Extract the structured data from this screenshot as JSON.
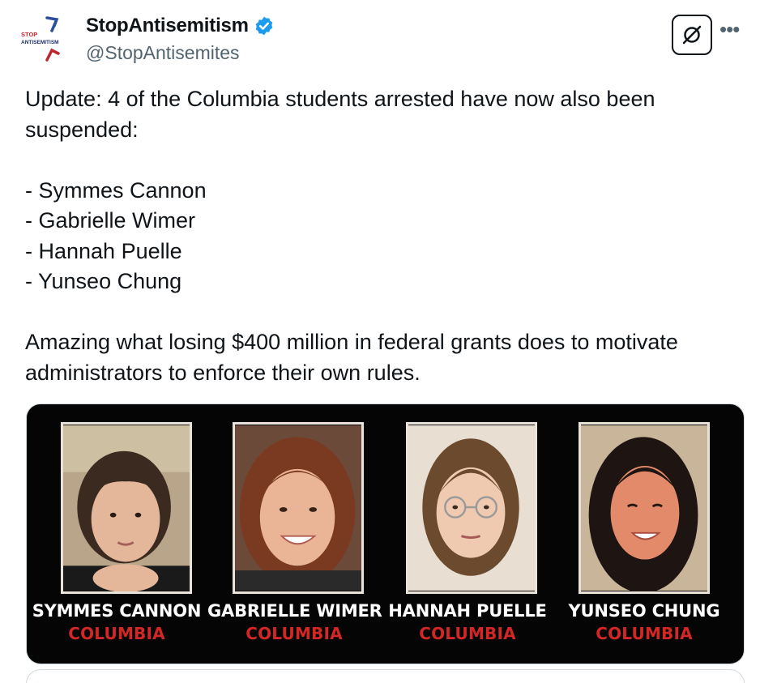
{
  "author": {
    "display_name": "StopAntisemitism",
    "handle": "@StopAntisemites",
    "verified": true,
    "logo_text_top": "STOP",
    "logo_text_bottom": "ANTISEMITISM"
  },
  "icons": {
    "verified": "verified-badge-icon",
    "grok": "grok-icon",
    "more": "more-icon"
  },
  "tweet": {
    "line1": "Update: 4 of the Columbia students arrested have now also been suspended:",
    "list": [
      "- Symmes Cannon",
      "- Gabrielle Wimer",
      "- Hannah Puelle",
      "- Yunseo Chung"
    ],
    "line2": "Amazing what losing $400 million in federal grants does to motivate administrators to enforce their own rules."
  },
  "media": {
    "people": [
      {
        "name": "SYMMES CANNON",
        "school": "COLUMBIA"
      },
      {
        "name": "GABRIELLE WIMER",
        "school": "COLUMBIA"
      },
      {
        "name": "HANNAH PUELLE",
        "school": "COLUMBIA"
      },
      {
        "name": "YUNSEO CHUNG",
        "school": "COLUMBIA"
      }
    ]
  },
  "colors": {
    "text": "#0f1419",
    "secondary": "#536471",
    "verified": "#1d9bf0",
    "school_red": "#d32626",
    "media_bg": "#050505"
  }
}
